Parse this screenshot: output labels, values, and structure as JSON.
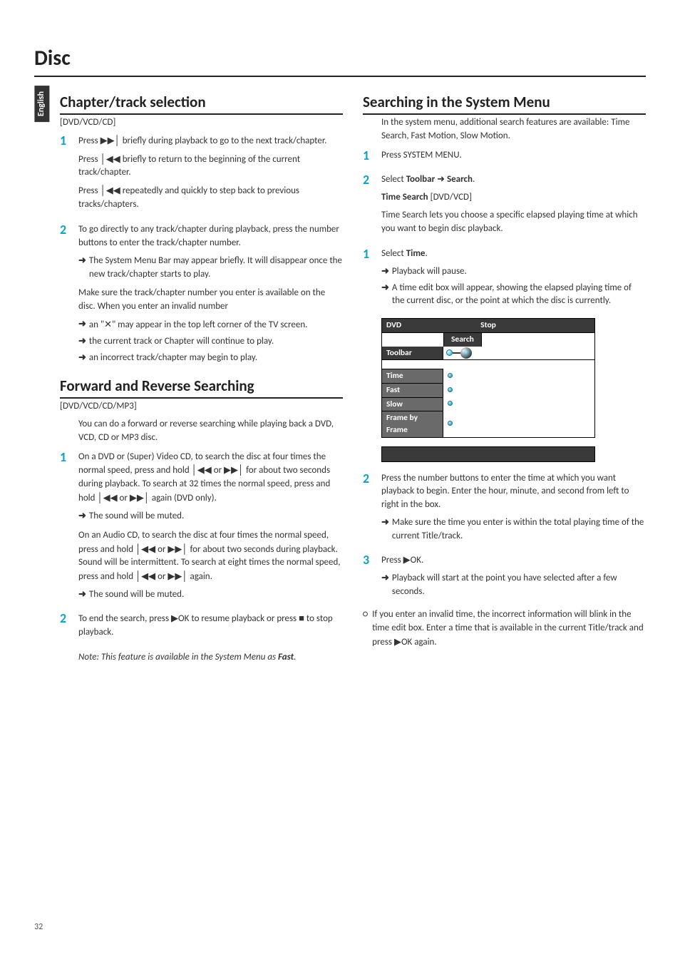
{
  "page": {
    "language_tab": "English",
    "title": "Disc",
    "page_number": "32"
  },
  "left": {
    "section1": {
      "title": "Chapter/track selection",
      "subtitle": "[DVD/VCD/CD]",
      "step1": {
        "p1a": "Press ",
        "p1b": " briefly during playback to go to the next track/chapter.",
        "p2a": "Press ",
        "p2b": " briefly to return to the beginning of the current track/chapter.",
        "p3a": "Press ",
        "p3b": " repeatedly and quickly to step back to previous tracks/chapters."
      },
      "step2": {
        "p1": "To go directly to any track/chapter during playback, press the number buttons to enter the track/chapter number.",
        "a1": "The System Menu Bar may appear briefly. It will disappear once the new track/chapter starts to play.",
        "p2": "Make sure the track/chapter number you enter is available on the disc. When you enter an invalid number",
        "a2a": "an \"",
        "a2b": "\" may appear in the top left corner of the TV screen.",
        "a3": "the current track or Chapter will continue to play.",
        "a4": "an incorrect track/chapter may begin to play."
      }
    },
    "section2": {
      "title": "Forward and Reverse Searching",
      "subtitle": "[DVD/VCD/CD/MP3]",
      "intro": "You can do a forward or reverse searching while playing back a DVD, VCD, CD or MP3 disc.",
      "step1": {
        "p1a": "On a DVD or (Super) Video CD, to search the disc at four times the normal speed, press and hold ",
        "p1b": " or ",
        "p1c": " for about two seconds during playback. To search at 32 times the normal speed, press and hold ",
        "p1d": " or ",
        "p1e": " again (DVD only).",
        "a1": "The sound will be muted.",
        "p2a": "On an Audio CD, to search the disc at four times the normal speed, press and hold ",
        "p2b": " or ",
        "p2c": " for about two seconds during playback. Sound will be intermittent. To search at eight times the normal speed, press and hold ",
        "p2d": " or ",
        "p2e": " again.",
        "a2": "The sound will be muted."
      },
      "step2": {
        "p1a": "To end the search, press ",
        "p1b": "OK to resume playback or press ",
        "p1c": " to stop playback."
      },
      "note_a": "Note: This feature is available in the System Menu as ",
      "note_b": "Fast",
      "note_c": "."
    }
  },
  "right": {
    "section1": {
      "title": "Searching in the System Menu",
      "intro": "In the system menu, additional search features are available: Time Search, Fast Motion, Slow Motion.",
      "step1": "Press SYSTEM MENU.",
      "step2a": "Select ",
      "step2b": "Toolbar",
      "step2c": " ➜ ",
      "step2d": "Search",
      "step2e": ".",
      "sub_heading": "Time Search",
      "sub_heading_suffix": " [DVD/VCD]",
      "sub_p": "Time Search lets you choose a specific elapsed playing time at which you want to begin disc playback.",
      "ts1": {
        "p1a": "Select ",
        "p1b": "Time",
        "p1c": ".",
        "a1": "Playback will pause.",
        "a2": "A time edit box will appear, showing the elapsed playing time of the current disc, or the point at which the disc is currently."
      },
      "ts2": {
        "p1": "Press the number buttons to enter the time at which you want playback to begin. Enter the hour, minute, and second from left to right in the box.",
        "a1": "Make sure the time you enter is within the total playing time of the current Title/track."
      },
      "ts3": {
        "p1a": "Press ",
        "p1b": "OK.",
        "a1": "Playback will start at the point you have selected after a few seconds."
      },
      "circle": {
        "p1a": "If you enter an invalid time, the incorrect information will blink in the time edit box. Enter a time that is available in the current Title/track and press ",
        "p1b": "OK again."
      }
    },
    "menu": {
      "dvd": "DVD",
      "stop": "Stop",
      "search": "Search",
      "toolbar": "Toolbar",
      "time": "Time",
      "fast": "Fast",
      "slow": "Slow",
      "fbf": "Frame by Frame"
    }
  },
  "icons": {
    "next": "▶▶│",
    "prev": "│◀◀",
    "play": "▶",
    "stop": "■",
    "x": "✕",
    "arrow": "➜",
    "circ": "○"
  }
}
